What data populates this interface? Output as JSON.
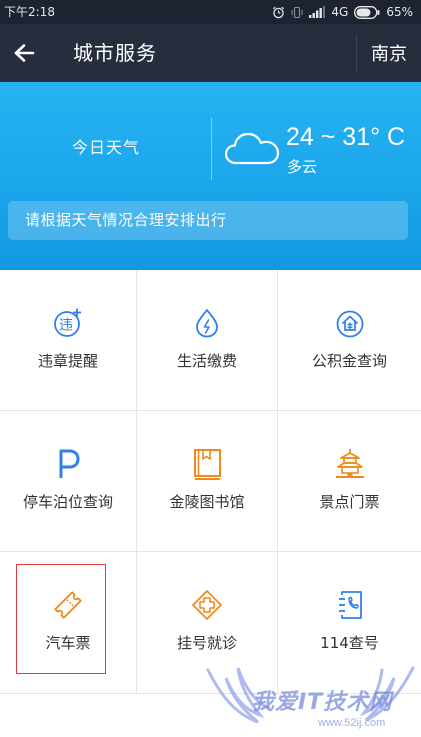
{
  "status_bar": {
    "time": "下午2:18",
    "network": "4G",
    "battery": "65%",
    "icons": [
      "alarm-icon",
      "vibrate-icon",
      "signal-icon",
      "battery-icon"
    ]
  },
  "header": {
    "title": "城市服务",
    "city": "南京",
    "back_icon": "arrow-left-icon"
  },
  "weather": {
    "label": "今日天气",
    "temperature": "24 ~ 31° C",
    "condition": "多云",
    "icon": "cloud-icon",
    "tip": "请根据天气情况合理安排出行"
  },
  "services": [
    {
      "label": "违章提醒",
      "icon": "traffic-violation-icon",
      "color": "#2f80ed"
    },
    {
      "label": "生活缴费",
      "icon": "water-drop-icon",
      "color": "#2f80ed"
    },
    {
      "label": "公积金查询",
      "icon": "housing-fund-icon",
      "color": "#2f80ed"
    },
    {
      "label": "停车泊位查询",
      "icon": "parking-icon",
      "color": "#2f80ed"
    },
    {
      "label": "金陵图书馆",
      "icon": "book-icon",
      "color": "#f08a1c"
    },
    {
      "label": "景点门票",
      "icon": "pagoda-icon",
      "color": "#f08a1c"
    },
    {
      "label": "汽车票",
      "icon": "ticket-icon",
      "color": "#f08a1c"
    },
    {
      "label": "挂号就诊",
      "icon": "medical-cross-icon",
      "color": "#f08a1c"
    },
    {
      "label": "114查号",
      "icon": "phone-book-icon",
      "color": "#2f80ed"
    }
  ],
  "watermark": {
    "text": "我爱IT技术网",
    "url": "www.52ij.com"
  },
  "colors": {
    "status_bar": "#1d2331",
    "title_bar": "#262d3d",
    "weather_banner": "#1aa6ea",
    "highlight_border": "#e23b3b",
    "icon_blue": "#2f80ed",
    "icon_orange": "#f08a1c"
  }
}
